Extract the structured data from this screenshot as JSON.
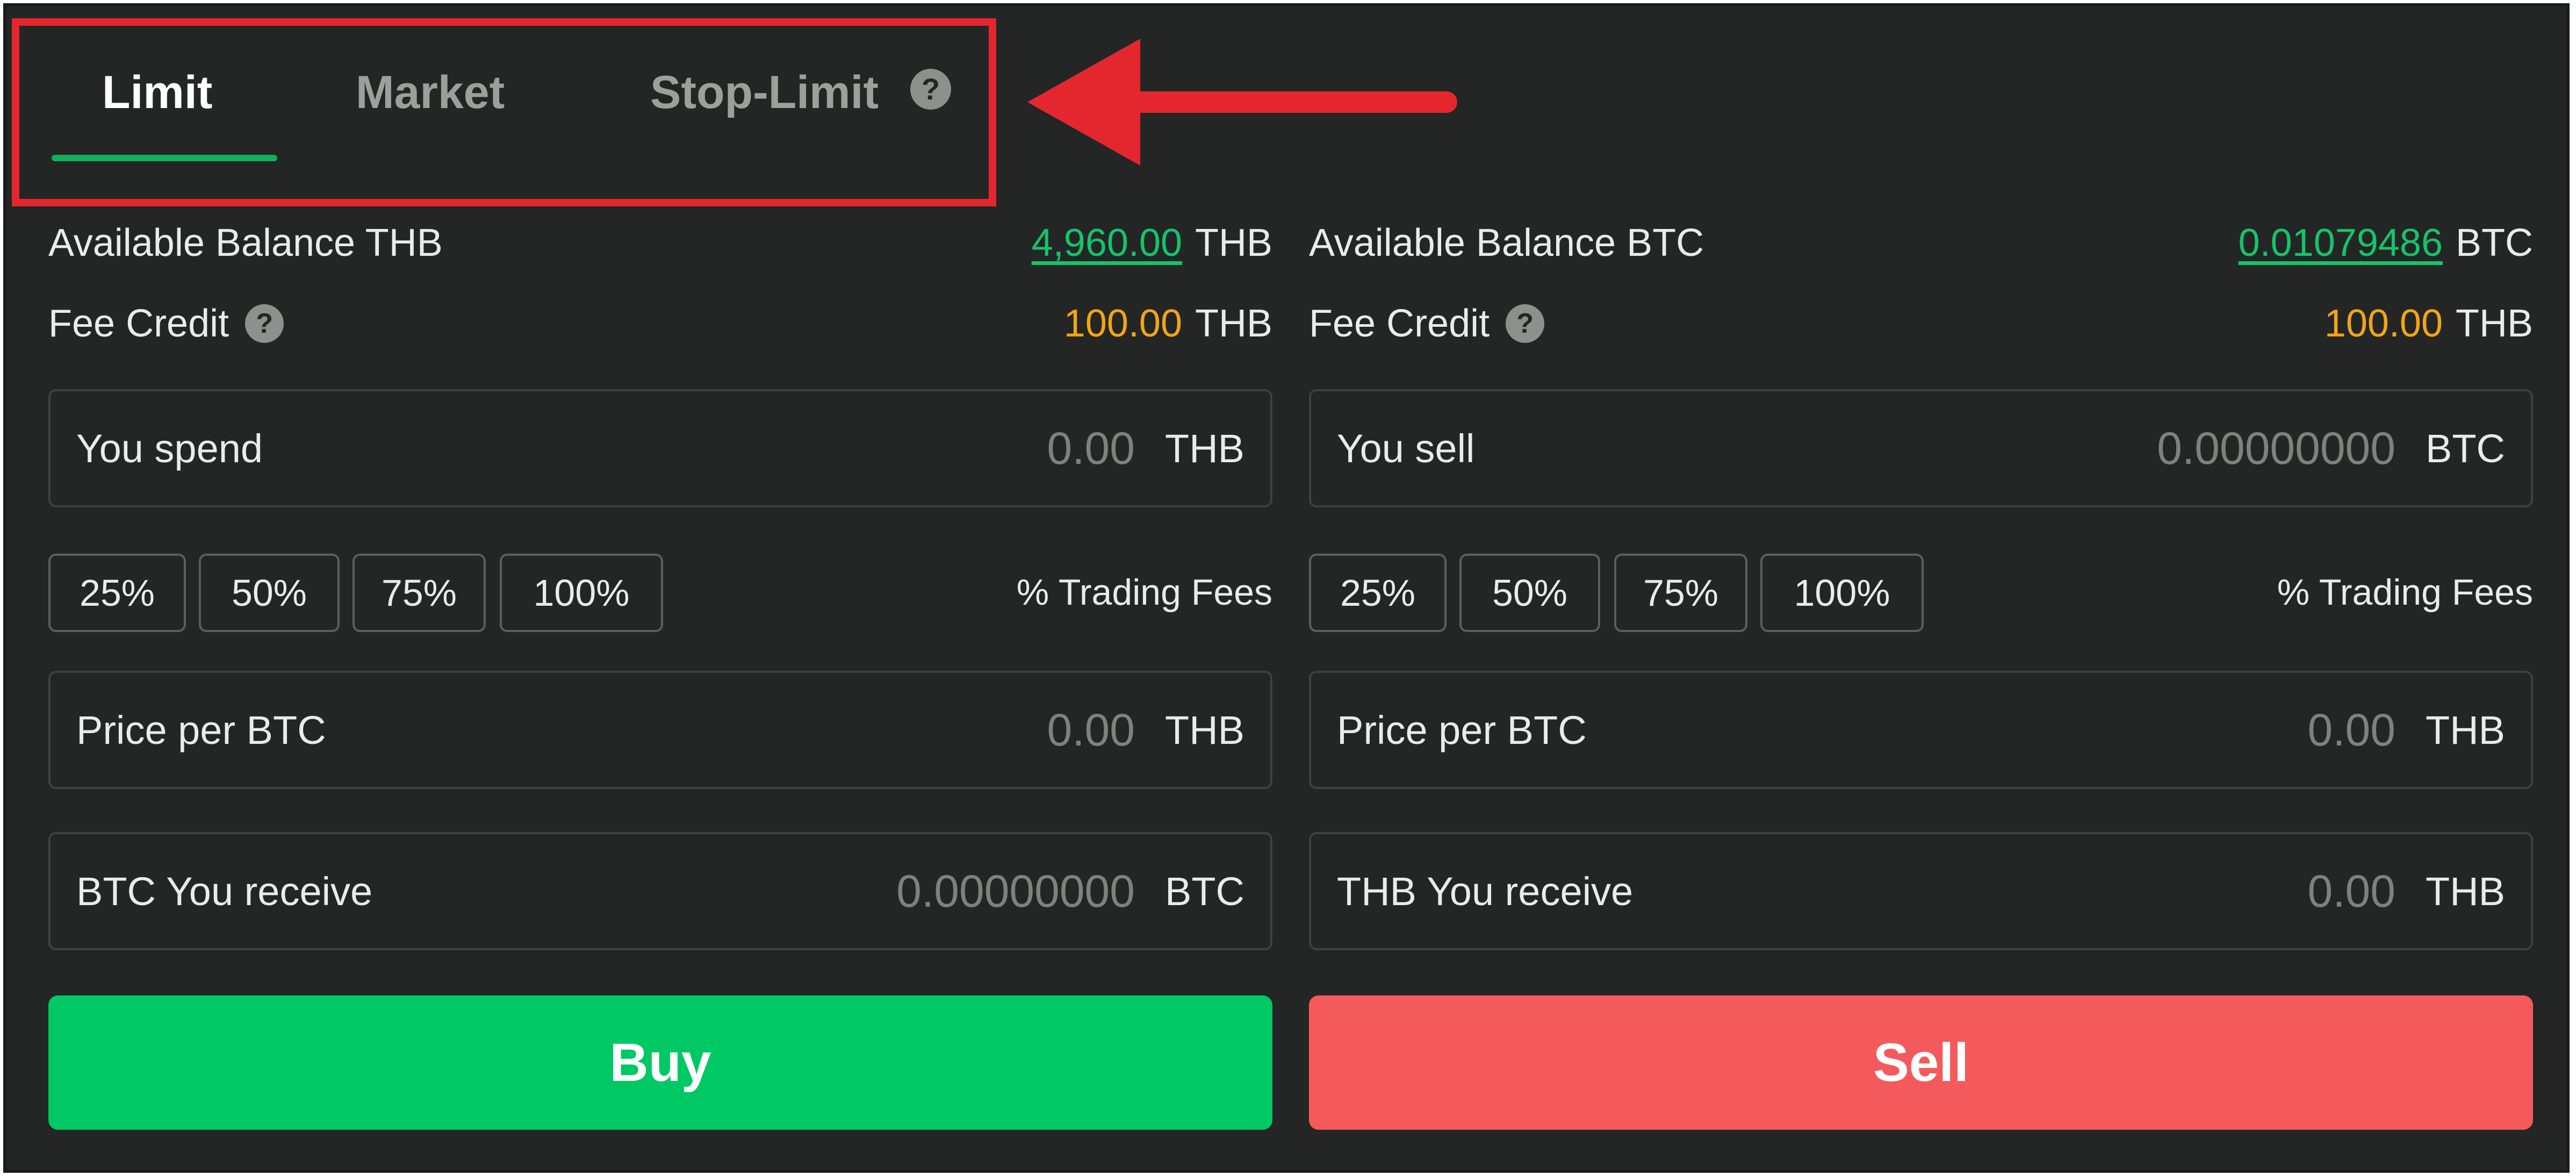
{
  "tabs": [
    {
      "label": "Limit",
      "active": true
    },
    {
      "label": "Market",
      "active": false
    },
    {
      "label": "Stop-Limit",
      "active": false
    }
  ],
  "help_glyph": "?",
  "colors": {
    "panel_bg": "#232624",
    "accent_green": "#0eb15e",
    "buy_button": "#00c864",
    "sell_button": "#f45a5c",
    "fee_orange": "#f0a617",
    "annotation_red": "#e4272e"
  },
  "buy": {
    "balance_label": "Available Balance THB",
    "balance_value": "4,960.00",
    "balance_unit": "THB",
    "fee_label": "Fee Credit",
    "fee_value": "100.00",
    "fee_unit": "THB",
    "spend_label": "You spend",
    "spend_value": "0.00",
    "spend_unit": "THB",
    "percents": [
      "25%",
      "50%",
      "75%",
      "100%"
    ],
    "fees_label": "% Trading Fees",
    "price_label": "Price per BTC",
    "price_value": "0.00",
    "price_unit": "THB",
    "receive_label": "BTC You receive",
    "receive_value": "0.00000000",
    "receive_unit": "BTC",
    "button_label": "Buy"
  },
  "sell": {
    "balance_label": "Available Balance BTC",
    "balance_value": "0.01079486",
    "balance_unit": "BTC",
    "fee_label": "Fee Credit",
    "fee_value": "100.00",
    "fee_unit": "THB",
    "sell_label": "You sell",
    "sell_value": "0.00000000",
    "sell_unit": "BTC",
    "percents": [
      "25%",
      "50%",
      "75%",
      "100%"
    ],
    "fees_label": "% Trading Fees",
    "price_label": "Price per BTC",
    "price_value": "0.00",
    "price_unit": "THB",
    "receive_label": "THB You receive",
    "receive_value": "0.00",
    "receive_unit": "THB",
    "button_label": "Sell"
  }
}
